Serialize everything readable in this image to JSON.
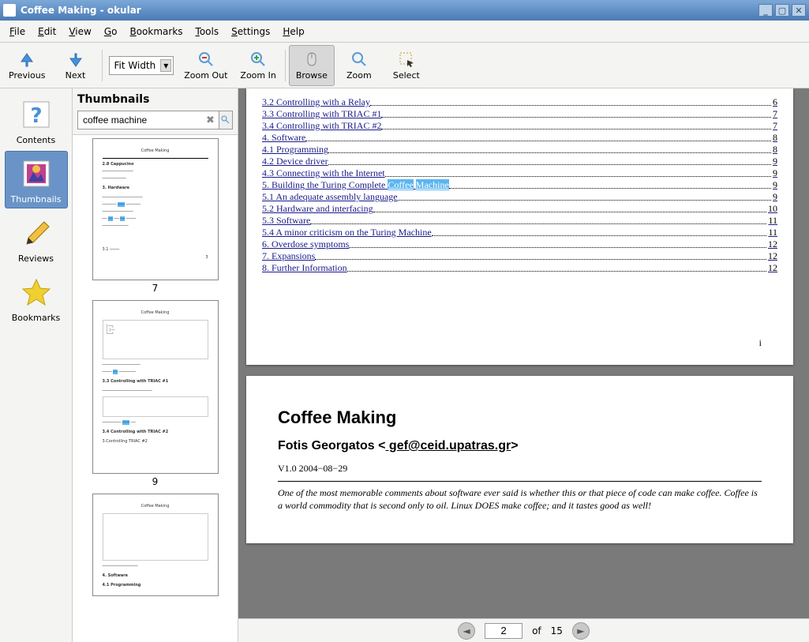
{
  "window": {
    "title": "Coffee Making - okular"
  },
  "menu": {
    "file": "File",
    "edit": "Edit",
    "view": "View",
    "go": "Go",
    "bookmarks": "Bookmarks",
    "tools": "Tools",
    "settings": "Settings",
    "help": "Help"
  },
  "toolbar": {
    "previous": "Previous",
    "next": "Next",
    "zoom_value": "Fit Width",
    "zoom_out": "Zoom Out",
    "zoom_in": "Zoom In",
    "browse": "Browse",
    "zoom": "Zoom",
    "select": "Select"
  },
  "sidebar": {
    "contents": "Contents",
    "thumbnails": "Thumbnails",
    "reviews": "Reviews",
    "bookmarks": "Bookmarks"
  },
  "thumbnails": {
    "header": "Thumbnails",
    "search_value": "coffee machine",
    "pages": [
      "7",
      "9"
    ]
  },
  "toc": [
    {
      "title": "3.2 Controlling with a Relay",
      "page": "6"
    },
    {
      "title": "3.3 Controlling with TRIAC #1",
      "page": "7"
    },
    {
      "title": "3.4 Controlling with TRIAC #2",
      "page": "7"
    },
    {
      "title": "4. Software",
      "page": "8"
    },
    {
      "title": "4.1 Programming",
      "page": "8"
    },
    {
      "title": "4.2 Device driver",
      "page": "9"
    },
    {
      "title": "4.3 Connecting with the Internet",
      "page": "9"
    },
    {
      "title": "5. Building the Turing Complete ",
      "hl": "Coffee Machine",
      "page": "9"
    },
    {
      "title": "5.1 An adequate assembly language",
      "page": "9"
    },
    {
      "title": "5.2 Hardware and interfacing",
      "page": "10"
    },
    {
      "title": "5.3 Software",
      "page": "11"
    },
    {
      "title": "5.4 A minor criticism on the Turing Machine",
      "page": "11"
    },
    {
      "title": "6. Overdose symptoms",
      "page": "12"
    },
    {
      "title": "7. Expansions",
      "page": "12"
    },
    {
      "title": "8. Further Information",
      "page": "12"
    }
  ],
  "toc_footer_page": "i",
  "doc": {
    "title": "Coffee Making",
    "author_line": "Fotis Georgatos <",
    "author_email": " gef@ceid.upatras.gr",
    "author_close": ">",
    "version": "V1.0 2004−08−29",
    "intro": "One of the most memorable comments about software ever said is whether this or that piece of code can make coffee. Coffee is a world commodity that is second only to oil. Linux DOES make coffee; and it tastes good as well!"
  },
  "pagenav": {
    "current": "2",
    "of": "of",
    "total": "15"
  }
}
